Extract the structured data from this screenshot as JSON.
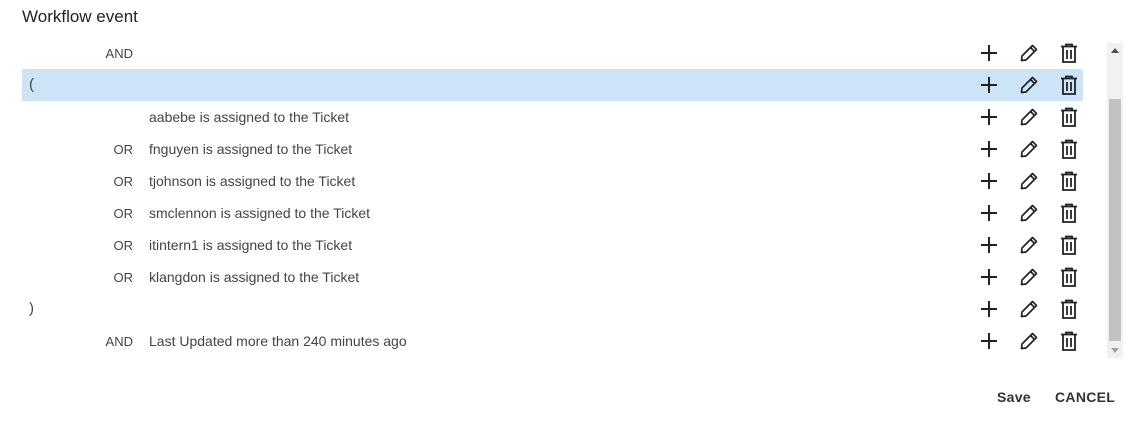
{
  "dialog": {
    "title": "Workflow event"
  },
  "rows": [
    {
      "paren": "",
      "op": "AND",
      "text": "",
      "selected": false
    },
    {
      "paren": "(",
      "op": "",
      "text": "",
      "selected": true
    },
    {
      "paren": "",
      "op": "",
      "text": "aabebe is assigned to the Ticket",
      "selected": false
    },
    {
      "paren": "",
      "op": "OR",
      "text": "fnguyen is assigned to the Ticket",
      "selected": false
    },
    {
      "paren": "",
      "op": "OR",
      "text": "tjohnson is assigned to the Ticket",
      "selected": false
    },
    {
      "paren": "",
      "op": "OR",
      "text": "smclennon is assigned to the Ticket",
      "selected": false
    },
    {
      "paren": "",
      "op": "OR",
      "text": "itintern1 is assigned to the Ticket",
      "selected": false
    },
    {
      "paren": "",
      "op": "OR",
      "text": "klangdon is assigned to the Ticket",
      "selected": false
    },
    {
      "paren": ")",
      "op": "",
      "text": "",
      "selected": false
    },
    {
      "paren": "",
      "op": "AND",
      "text": "Last Updated more than 240 minutes ago",
      "selected": false
    }
  ],
  "row_actions": {
    "add_icon": "plus-icon",
    "edit_icon": "pencil-icon",
    "delete_icon": "trash-icon"
  },
  "footer": {
    "save_label": "Save",
    "cancel_label": "CANCEL"
  },
  "colors": {
    "selected_row": "#cce4f6",
    "icon": "#222222"
  }
}
